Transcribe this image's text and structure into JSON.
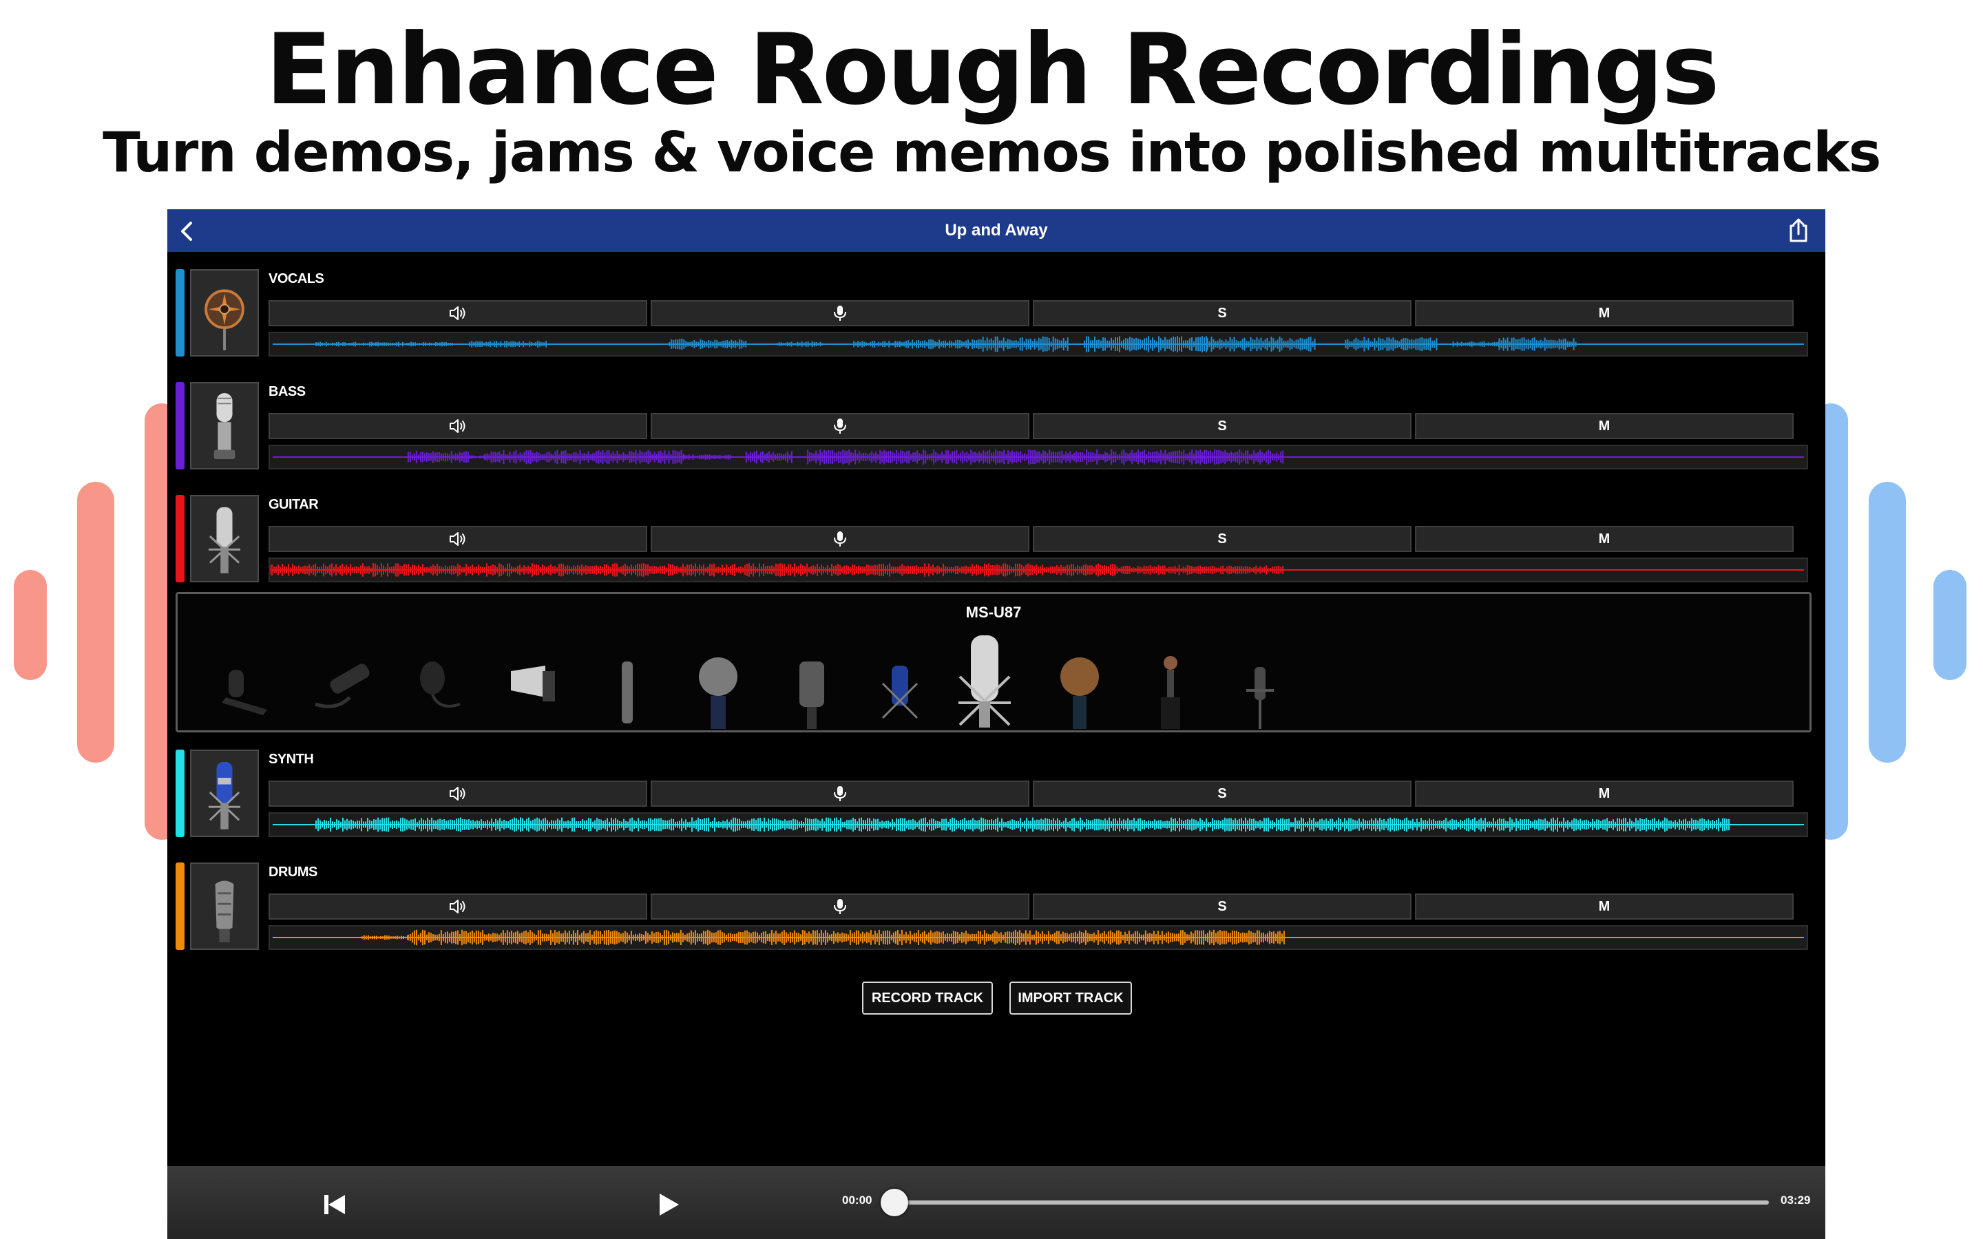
{
  "headline": {
    "title": "Enhance Rough Recordings",
    "subtitle": "Turn demos, jams & voice memos into polished multitracks"
  },
  "decor": {
    "left_color": "#f9968a",
    "right_color": "#8fc1f5"
  },
  "topbar": {
    "title": "Up and Away",
    "color": "#1e3a8a"
  },
  "tracks": [
    {
      "name": "VOCALS",
      "color": "#1f8fd0",
      "solo": "S",
      "mute": "M"
    },
    {
      "name": "BASS",
      "color": "#6a1fd6",
      "solo": "S",
      "mute": "M"
    },
    {
      "name": "GUITAR",
      "color": "#e8141a",
      "solo": "S",
      "mute": "M"
    },
    {
      "name": "SYNTH",
      "color": "#22dfe8",
      "solo": "S",
      "mute": "M"
    },
    {
      "name": "DRUMS",
      "color": "#f08a0c",
      "solo": "S",
      "mute": "M"
    }
  ],
  "mic_picker": {
    "selected": "MS-U87"
  },
  "actions": {
    "record": "RECORD TRACK",
    "import": "IMPORT TRACK"
  },
  "transport": {
    "time_current": "00:00",
    "time_total": "03:29",
    "progress": 0
  }
}
